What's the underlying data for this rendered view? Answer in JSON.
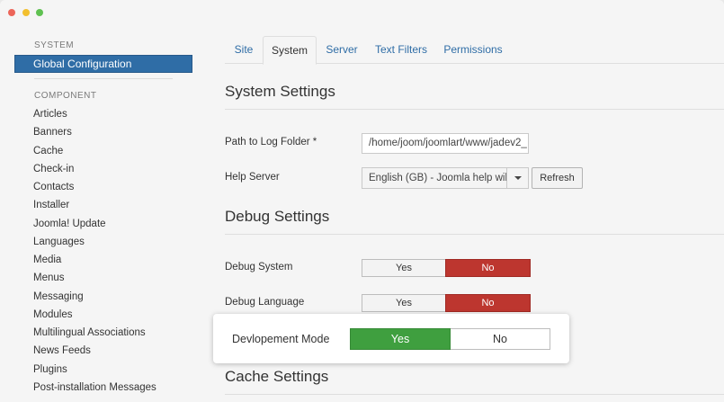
{
  "window": {
    "controls": [
      "close",
      "minimize",
      "maximize"
    ]
  },
  "sidebar": {
    "system_heading": "SYSTEM",
    "active_item": "Global Configuration",
    "component_heading": "COMPONENT",
    "items": [
      "Articles",
      "Banners",
      "Cache",
      "Check-in",
      "Contacts",
      "Installer",
      "Joomla! Update",
      "Languages",
      "Media",
      "Menus",
      "Messaging",
      "Modules",
      "Multilingual Associations",
      "News Feeds",
      "Plugins",
      "Post-installation Messages"
    ]
  },
  "tabs": [
    "Site",
    "System",
    "Server",
    "Text Filters",
    "Permissions"
  ],
  "active_tab": "System",
  "system_settings": {
    "title": "System Settings",
    "log_path_label": "Path to Log Folder *",
    "log_path_value": "/home/joom/joomlart/www/jadev2_",
    "help_server_label": "Help Server",
    "help_server_value": "English (GB) - Joomla help wiki",
    "refresh_label": "Refresh"
  },
  "debug_settings": {
    "title": "Debug Settings",
    "debug_system_label": "Debug System",
    "debug_language_label": "Debug Language",
    "yes_label": "Yes",
    "no_label": "No"
  },
  "cache_settings": {
    "title": "Cache Settings"
  },
  "callout": {
    "label": "Devlopement Mode",
    "yes_label": "Yes",
    "no_label": "No",
    "selected": "Yes"
  },
  "colors": {
    "accent": "#2f6da6",
    "no_active": "#bd362f",
    "yes_active": "#3f9f3f"
  }
}
